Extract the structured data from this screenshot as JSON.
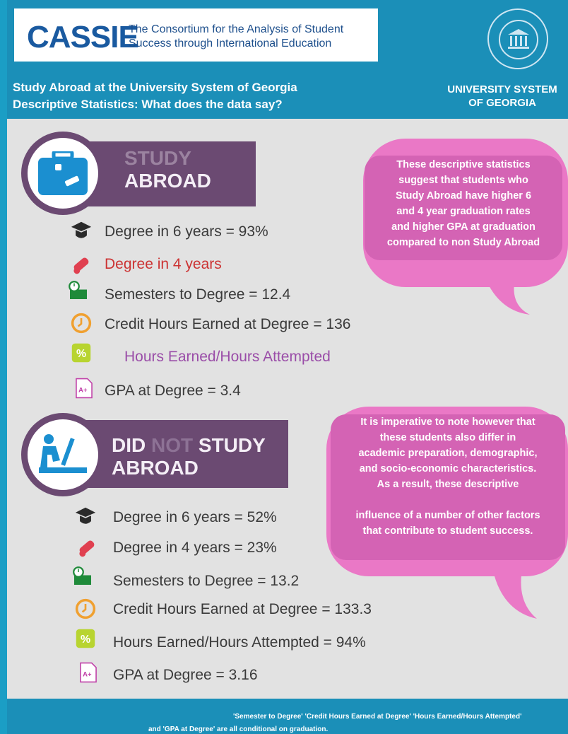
{
  "header": {
    "logo": "CASSIE",
    "consortium_line1": "The Consortium for the Analysis of Student",
    "consortium_line2": "Success through International Education",
    "title_line1": "Study Abroad at the University System of Georgia",
    "title_line2": "Descriptive Statistics: What does the data say?",
    "usg_line1": "UNIVERSITY SYSTEM",
    "usg_line2": "OF GEORGIA"
  },
  "study_abroad": {
    "heading_line1": "STUDY",
    "heading_line2": "ABROAD",
    "stats": [
      {
        "label": "Degree in 6 years = 93%"
      },
      {
        "label": "Degree in 4 years"
      },
      {
        "label": "Semesters to Degree = 12.4"
      },
      {
        "label": "Credit Hours Earned at Degree = 136"
      },
      {
        "label": "Hours Earned/Hours Attempted"
      },
      {
        "label": "GPA at Degree = 3.4"
      }
    ]
  },
  "did_not": {
    "heading_did": "DID",
    "heading_not": "NOT",
    "heading_study": "STUDY",
    "heading_line2": "ABROAD",
    "stats": [
      {
        "label": "Degree in 6 years = 52%"
      },
      {
        "label": "Degree in 4 years = 23%"
      },
      {
        "label": "Semesters to Degree = 13.2"
      },
      {
        "label": "Credit Hours Earned at Degree = 133.3"
      },
      {
        "label": "Hours Earned/Hours Attempted = 94%"
      },
      {
        "label": "GPA at Degree = 3.16"
      }
    ]
  },
  "bubble1": {
    "lines": [
      "These descriptive statistics",
      "suggest that students who",
      "Study Abroad have higher 6",
      "and 4 year graduation rates",
      "and higher GPA at graduation",
      "compared to non Study Abroad"
    ]
  },
  "bubble2": {
    "lines": [
      "It is imperative to note however that",
      "these students also differ in",
      "academic preparation, demographic,",
      "and socio-economic characteristics.",
      "As a result, these descriptive",
      "influence of a number of other factors",
      "that contribute to student success."
    ]
  },
  "footer": {
    "note_line1": "'Semester to Degree' 'Credit Hours Earned at Degree' 'Hours Earned/Hours Attempted'",
    "note_line2": "and 'GPA at Degree' are all conditional on graduation."
  },
  "colors": {
    "brand_blue": "#1b8fb8",
    "purple": "#6b4a72",
    "pink": "#d463b4"
  }
}
